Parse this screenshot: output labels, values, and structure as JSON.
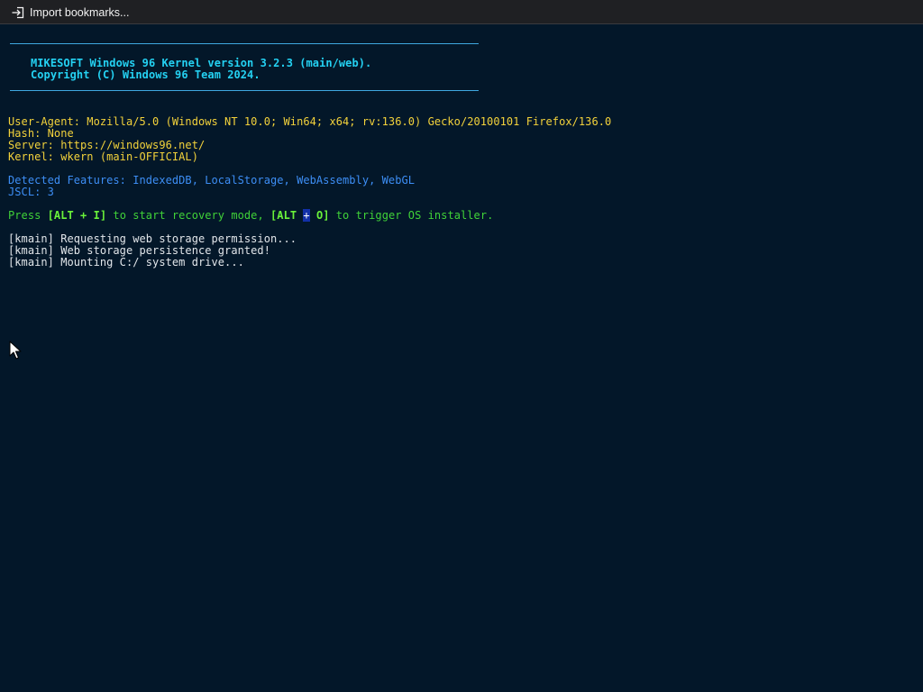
{
  "bookmarks_bar": {
    "import_label": "Import bookmarks...",
    "import_icon": "import-arrow-icon"
  },
  "terminal": {
    "banner": {
      "line1": "MIKESOFT Windows 96 Kernel version 3.2.3 (main/web).",
      "line2": "Copyright (C) Windows 96 Team 2024."
    },
    "info": {
      "user_agent": "User-Agent: Mozilla/5.0 (Windows NT 10.0; Win64; x64; rv:136.0) Gecko/20100101 Firefox/136.0",
      "hash": "Hash: None",
      "server": "Server: https://windows96.net/",
      "kernel": "Kernel: wkern (main-OFFICIAL)"
    },
    "features": {
      "detected": "Detected Features: IndexedDB, LocalStorage, WebAssembly, WebGL",
      "jscl": "JSCL: 3"
    },
    "prompt": {
      "press": "Press ",
      "key1": "[ALT + I]",
      "mid": " to start recovery mode, ",
      "key2_open": "[ALT ",
      "key2_plus": "+",
      "key2_close": " O]",
      "end": " to trigger OS installer."
    },
    "log": [
      "[kmain] Requesting web storage permission...",
      "[kmain] Web storage persistence granted!",
      "[kmain] Mounting C:/ system drive..."
    ]
  },
  "colors": {
    "background": "#031729",
    "banner": "#24d1f2",
    "info": "#f3d23b",
    "features": "#3d8ef5",
    "prompt": "#40d238",
    "log": "#e2e6ea"
  },
  "pointer": "mouse-pointer-icon"
}
